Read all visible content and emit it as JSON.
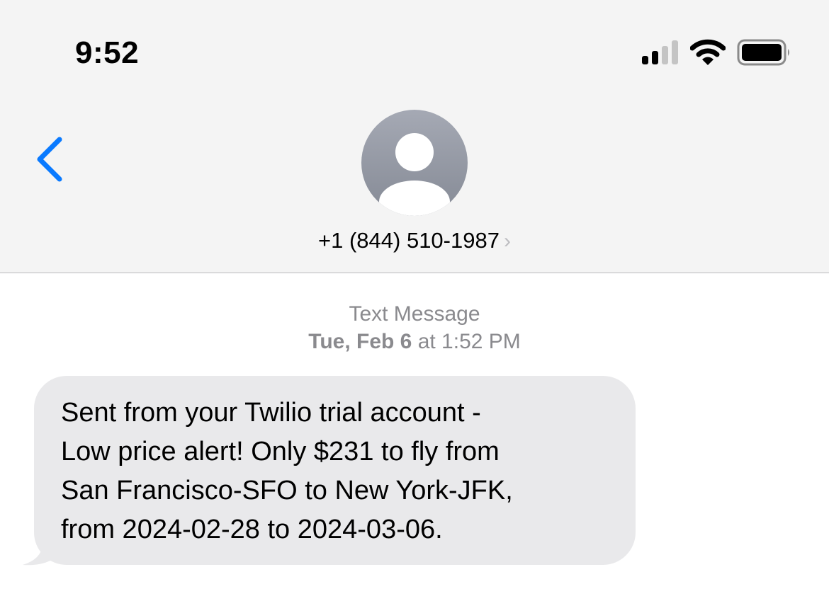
{
  "status_bar": {
    "time": "9:52",
    "signal_bars_active": 2,
    "signal_bars_total": 4,
    "wifi": "wifi-icon",
    "battery_level": 1.0
  },
  "header": {
    "back_icon": "chevron-left-icon",
    "avatar_icon": "person-icon",
    "contact": "+1 (844) 510-1987",
    "contact_chevron": "›"
  },
  "conversation": {
    "service_label": "Text Message",
    "date_day": "Tue, Feb 6",
    "date_time": " at 1:52 PM",
    "messages": [
      {
        "direction": "incoming",
        "text": "Sent from your Twilio trial account -\nLow price alert! Only $231 to fly from\nSan Francisco-SFO to New York-JFK,\nfrom 2024-02-28 to 2024-03-06."
      }
    ]
  },
  "colors": {
    "accent": "#0a7aff",
    "bubble_incoming": "#e9e9eb",
    "header_bg": "#f4f4f4"
  }
}
